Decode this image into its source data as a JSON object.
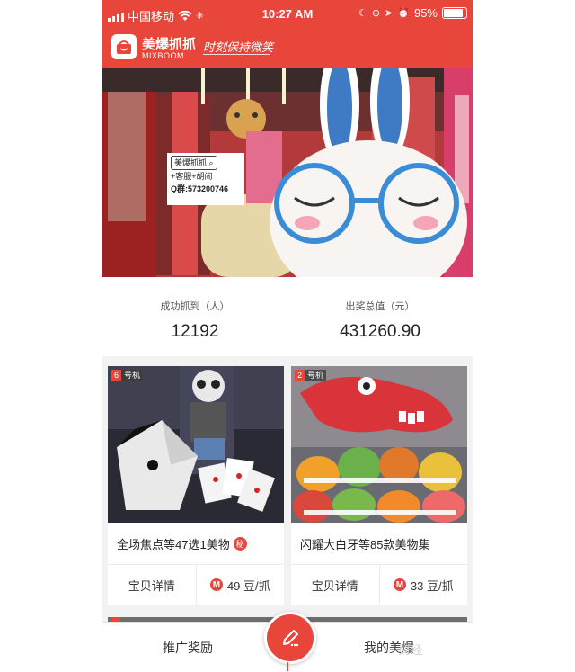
{
  "statusbar": {
    "carrier": "中国移动",
    "time": "10:27 AM",
    "battery": "95%",
    "battery_level": 0.95
  },
  "header": {
    "logo_title": "美爆抓抓",
    "logo_sub": "MIXBOOM",
    "slogan": "时刻保持微笑"
  },
  "hero": {
    "sign_title": "美爆抓抓",
    "sign_line2": "+客服+胡闹",
    "sign_line3": "Q群:573200746"
  },
  "stats": [
    {
      "label": "成功抓到（人）",
      "value": "12192"
    },
    {
      "label": "出奖总值（元）",
      "value": "431260.90"
    }
  ],
  "cards": [
    {
      "badge_num": "6",
      "badge_text": "号机",
      "title": "全场焦点等47选1美物",
      "secret": "秘",
      "detail": "宝贝详情",
      "price_icon": "M",
      "price": "49 豆/抓"
    },
    {
      "badge_num": "2",
      "badge_text": "号机",
      "title": "闪耀大白牙等85款美物集",
      "secret": "",
      "detail": "宝贝详情",
      "price_icon": "M",
      "price": "33 豆/抓"
    }
  ],
  "tabbar": {
    "left": "推广奖励",
    "right": "我的美爆"
  },
  "watermark": "财经",
  "colors": {
    "brand": "#e8463a"
  }
}
